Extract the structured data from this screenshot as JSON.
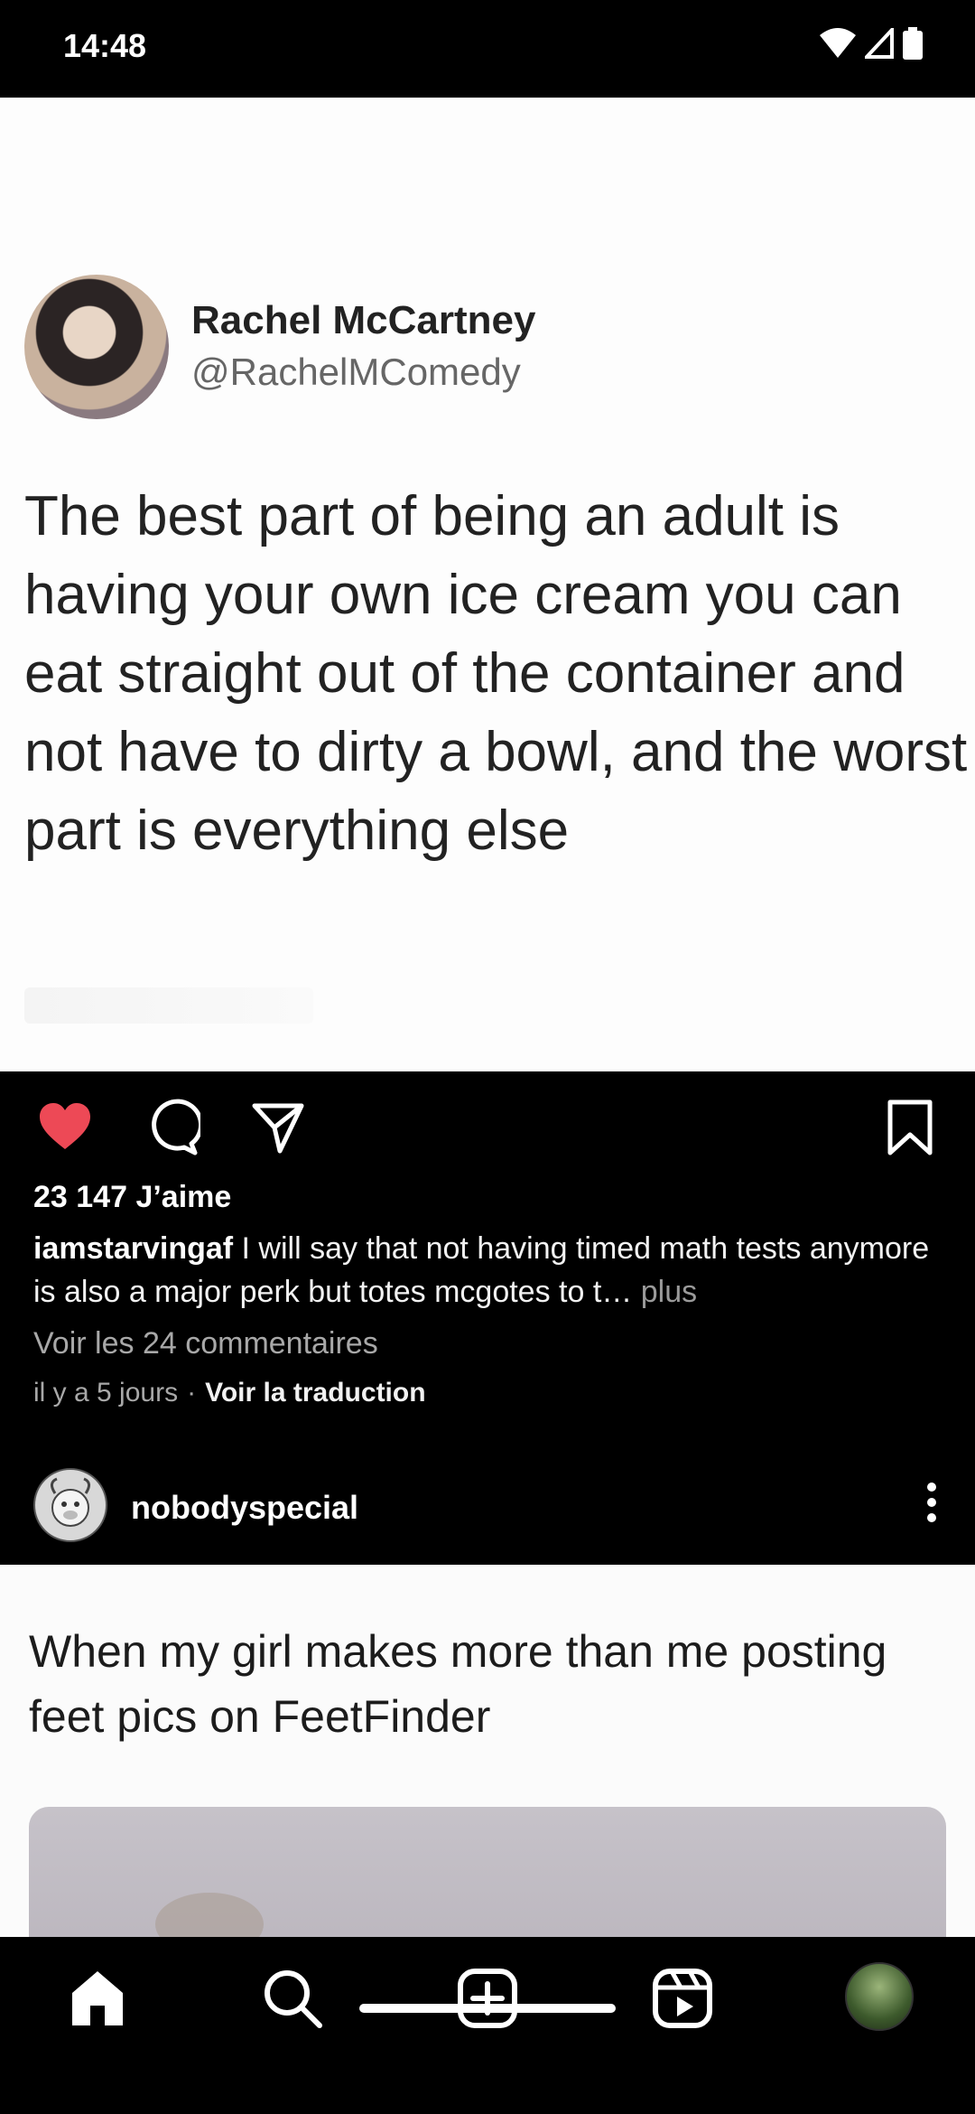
{
  "status_bar": {
    "time": "14:48",
    "icons": [
      "wifi-icon",
      "signal-icon",
      "battery-icon"
    ]
  },
  "post1": {
    "tweet": {
      "name": "Rachel McCartney",
      "handle": "@RachelMComedy",
      "text": "The best part of being an adult is having your own ice cream you can eat straight out of the container and not have to dirty a bowl, and the worst part is everything else"
    },
    "liked": true,
    "like_color": "#ed4956",
    "likes": "23 147 J’aime",
    "caption_user": "iamstarvingaf",
    "caption_text": " I will say that not having timed math tests anymore is also a major perk but totes mcgotes to t…",
    "caption_more": " plus",
    "view_comments": "Voir les 24 commentaires",
    "time_ago": "il y a 5 jours",
    "separator": "·",
    "translate": "Voir la traduction"
  },
  "post2": {
    "username": "nobodyspecial",
    "image_text": "When my girl makes more than me posting feet pics on FeetFinder"
  },
  "nav": {
    "items": [
      "home-icon",
      "search-icon",
      "create-icon",
      "reels-icon",
      "profile-avatar"
    ]
  }
}
